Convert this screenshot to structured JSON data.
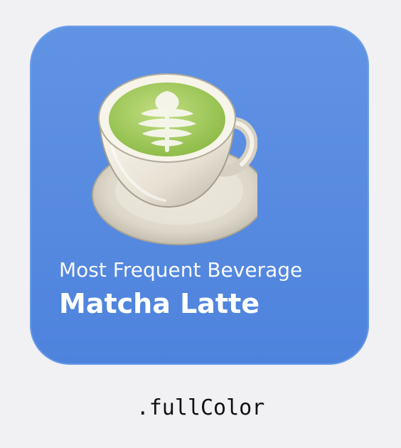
{
  "widget": {
    "subtitle": "Most Frequent Beverage",
    "title": "Matcha Latte",
    "image_icon": "matcha-latte-cup-icon",
    "background_color": "#5a8fe3"
  },
  "variant_label": ".fullColor"
}
